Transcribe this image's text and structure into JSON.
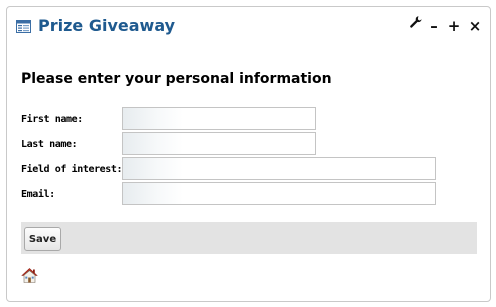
{
  "portlet": {
    "title": "Prize Giveaway",
    "controls": {
      "configure_icon": "wrench-icon",
      "minimize_label": "–",
      "maximize_label": "+",
      "close_label": "×"
    }
  },
  "form": {
    "heading": "Please enter your personal information",
    "fields": [
      {
        "label": "First name:",
        "value": ""
      },
      {
        "label": "Last name:",
        "value": ""
      },
      {
        "label": "Field of interest:",
        "value": ""
      },
      {
        "label": "Email:",
        "value": ""
      }
    ],
    "save_label": "Save"
  },
  "footer": {
    "home_icon": "home-icon"
  },
  "colors": {
    "title": "#1f5a8f",
    "button_bar": "#e3e3e3",
    "home_roof": "#d23a2a"
  }
}
